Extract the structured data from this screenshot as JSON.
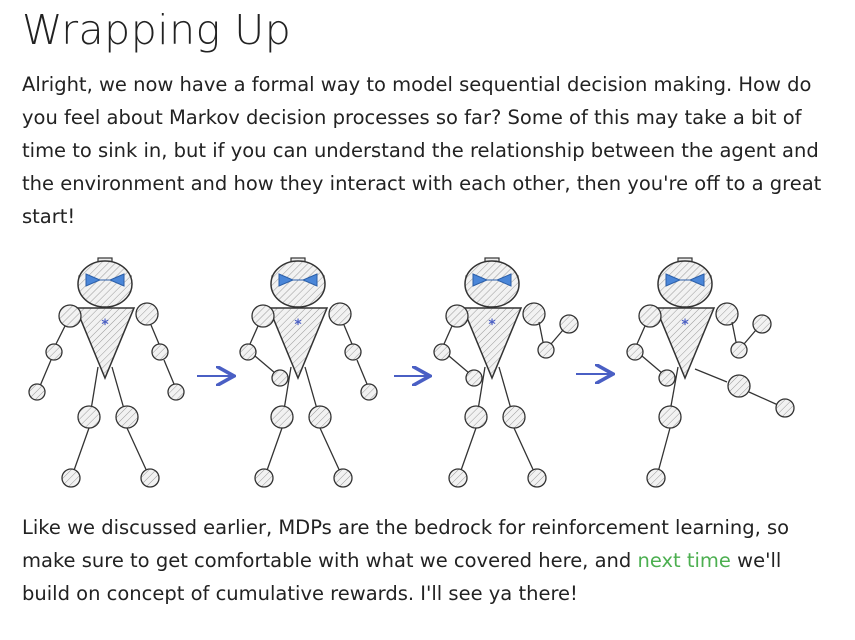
{
  "heading": "Wrapping Up",
  "intro_paragraph": "Alright, we now have a formal way to model sequential decision making. How do you feel about Markov decision processes so far? Some of this may take a bit of time to sink in, but if you can understand the relationship between the agent and the environment and how they interact with each other, then you're off to a great start!",
  "closing_paragraph": {
    "before_link": "Like we discussed earlier, MDPs are the bedrock for reinforcement learning, so make sure to get comfortable with what we covered here, and ",
    "link_text": "next time",
    "after_link": " we'll build on concept of cumulative rewards. I'll see ya there!"
  },
  "illustration": {
    "robot_poses": [
      "standing",
      "elbow-bent",
      "arm-raised",
      "leg-kick"
    ],
    "colors": {
      "eyes": "#4a86d8",
      "arrow": "#4a5fc4",
      "outline": "#333333",
      "hatch": "#bbbbbb",
      "link": "#4caf50"
    }
  }
}
